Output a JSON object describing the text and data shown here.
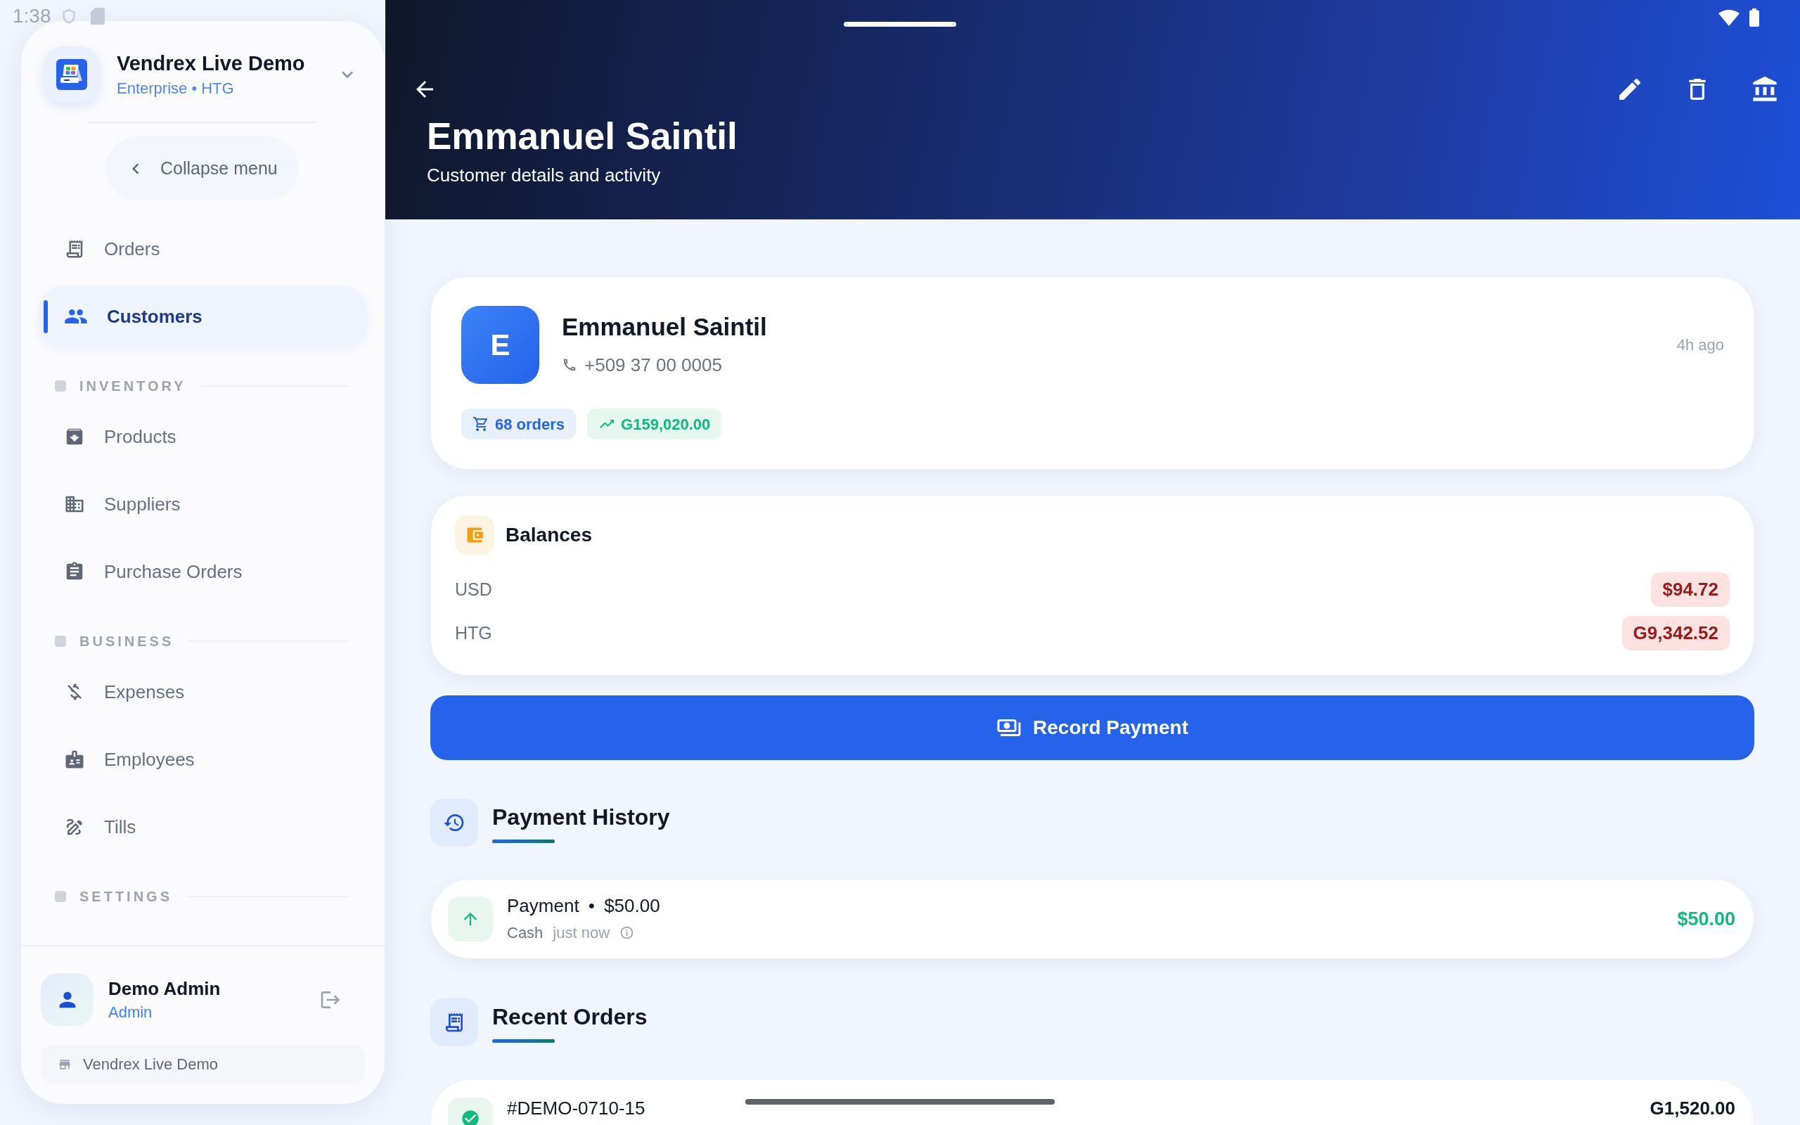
{
  "status_bar": {
    "time": "1:38"
  },
  "sidebar": {
    "workspace": {
      "name": "Vendrex Live Demo",
      "plan": "Enterprise • HTG"
    },
    "collapse_label": "Collapse menu",
    "nav": [
      {
        "items": [
          {
            "label": "Orders",
            "selected": false
          },
          {
            "label": "Customers",
            "selected": true
          }
        ]
      },
      {
        "title": "INVENTORY",
        "items": [
          {
            "label": "Products",
            "selected": false
          },
          {
            "label": "Suppliers",
            "selected": false
          },
          {
            "label": "Purchase Orders",
            "selected": false
          }
        ]
      },
      {
        "title": "BUSINESS",
        "items": [
          {
            "label": "Expenses",
            "selected": false
          },
          {
            "label": "Employees",
            "selected": false
          },
          {
            "label": "Tills",
            "selected": false
          }
        ]
      },
      {
        "title": "SETTINGS"
      }
    ],
    "user": {
      "name": "Demo Admin",
      "role": "Admin"
    },
    "store": "Vendrex Live Demo"
  },
  "header": {
    "title": "Emmanuel Saintil",
    "subtitle": "Customer details and activity"
  },
  "customer": {
    "initial": "E",
    "name": "Emmanuel Saintil",
    "phone": "+509 37 00 0005",
    "last_active": "4h ago",
    "orders_badge": "68 orders",
    "total_badge": "G159,020.00"
  },
  "balances": {
    "title": "Balances",
    "rows": [
      {
        "currency": "USD",
        "amount": "$94.72"
      },
      {
        "currency": "HTG",
        "amount": "G9,342.52"
      }
    ]
  },
  "record_payment_button": "Record Payment",
  "payment_history": {
    "title": "Payment History",
    "items": [
      {
        "title": "Payment • $50.00",
        "method": "Cash",
        "time": "just now",
        "amount": "$50.00"
      }
    ]
  },
  "recent_orders": {
    "title": "Recent Orders",
    "items": [
      {
        "number": "#DEMO-0710-15",
        "total": "G1,520.00"
      }
    ]
  }
}
